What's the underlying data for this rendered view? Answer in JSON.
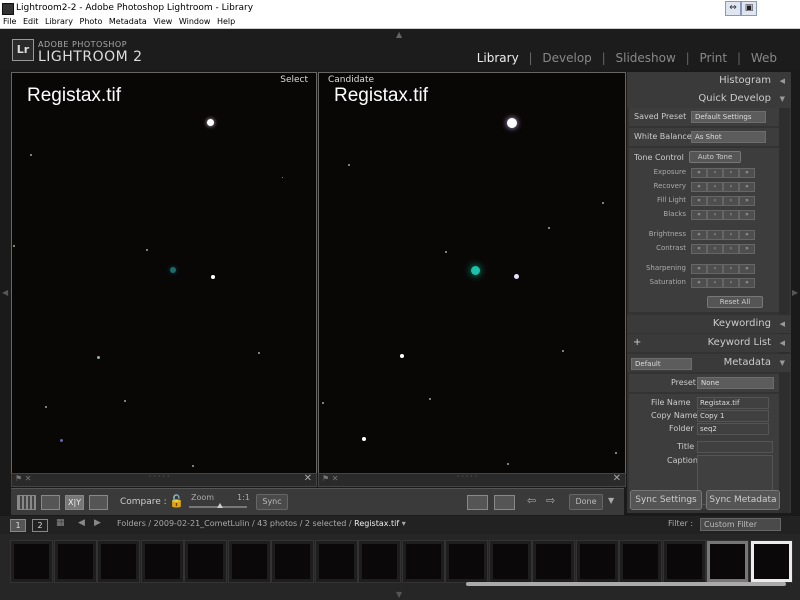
{
  "window": {
    "title": "Lightroom2-2 - Adobe Photoshop Lightroom - Library"
  },
  "menu": [
    "File",
    "Edit",
    "Library",
    "Photo",
    "Metadata",
    "View",
    "Window",
    "Help"
  ],
  "brand": {
    "badge": "Lr",
    "top": "ADOBE PHOTOSHOP",
    "main": "LIGHTROOM 2"
  },
  "modules": {
    "library": "Library",
    "develop": "Develop",
    "slideshow": "Slideshow",
    "print": "Print",
    "web": "Web",
    "separator": "|"
  },
  "compare": {
    "select_tag": "Select",
    "candidate_tag": "Candidate",
    "select_title": "Registax.tif",
    "candidate_title": "Registax.tif"
  },
  "toolbar": {
    "compare_label": "Compare :",
    "zoom_label": "Zoom",
    "zoom_ratio": "1:1",
    "sync_label": "Sync",
    "done_label": "Done",
    "xy_label": "X|Y"
  },
  "right_panel": {
    "histogram": "Histogram",
    "quick_develop": "Quick Develop",
    "saved_preset_label": "Saved Preset",
    "saved_preset_value": "Default Settings",
    "white_balance_label": "White Balance",
    "white_balance_value": "As Shot",
    "tone_control_label": "Tone Control",
    "auto_tone": "Auto Tone",
    "tone_rows": [
      "Exposure",
      "Recovery",
      "Fill Light",
      "Blacks"
    ],
    "presence_rows": [
      "Brightness",
      "Contrast"
    ],
    "color_rows": [
      "Sharpening",
      "Saturation"
    ],
    "reset_all": "Reset All",
    "keywording": "Keywording",
    "keyword_list": "Keyword List",
    "keyword_plus": "+",
    "metadata": "Metadata",
    "metadata_preset_dropdown": "Default",
    "preset_label": "Preset",
    "preset_value": "None",
    "file_name_label": "File Name",
    "file_name_value": "Registax.tif",
    "copy_name_label": "Copy Name",
    "copy_name_value": "Copy 1",
    "folder_label": "Folder",
    "folder_value": "seq2",
    "title_label": "Title",
    "caption_label": "Caption",
    "sync_settings": "Sync Settings",
    "sync_metadata": "Sync Metadata"
  },
  "filmstrip_bar": {
    "page1": "1",
    "page2": "2",
    "path": "Folders / 2009-02-21_CometLulin / 43 photos / 2 selected /",
    "current_file": "Registax.tif",
    "filter_label": "Filter :",
    "filter_value": "Custom Filter"
  },
  "colors": {
    "background": "#1a1a1a",
    "panel": "#333333",
    "comet": "#19c2a8"
  }
}
